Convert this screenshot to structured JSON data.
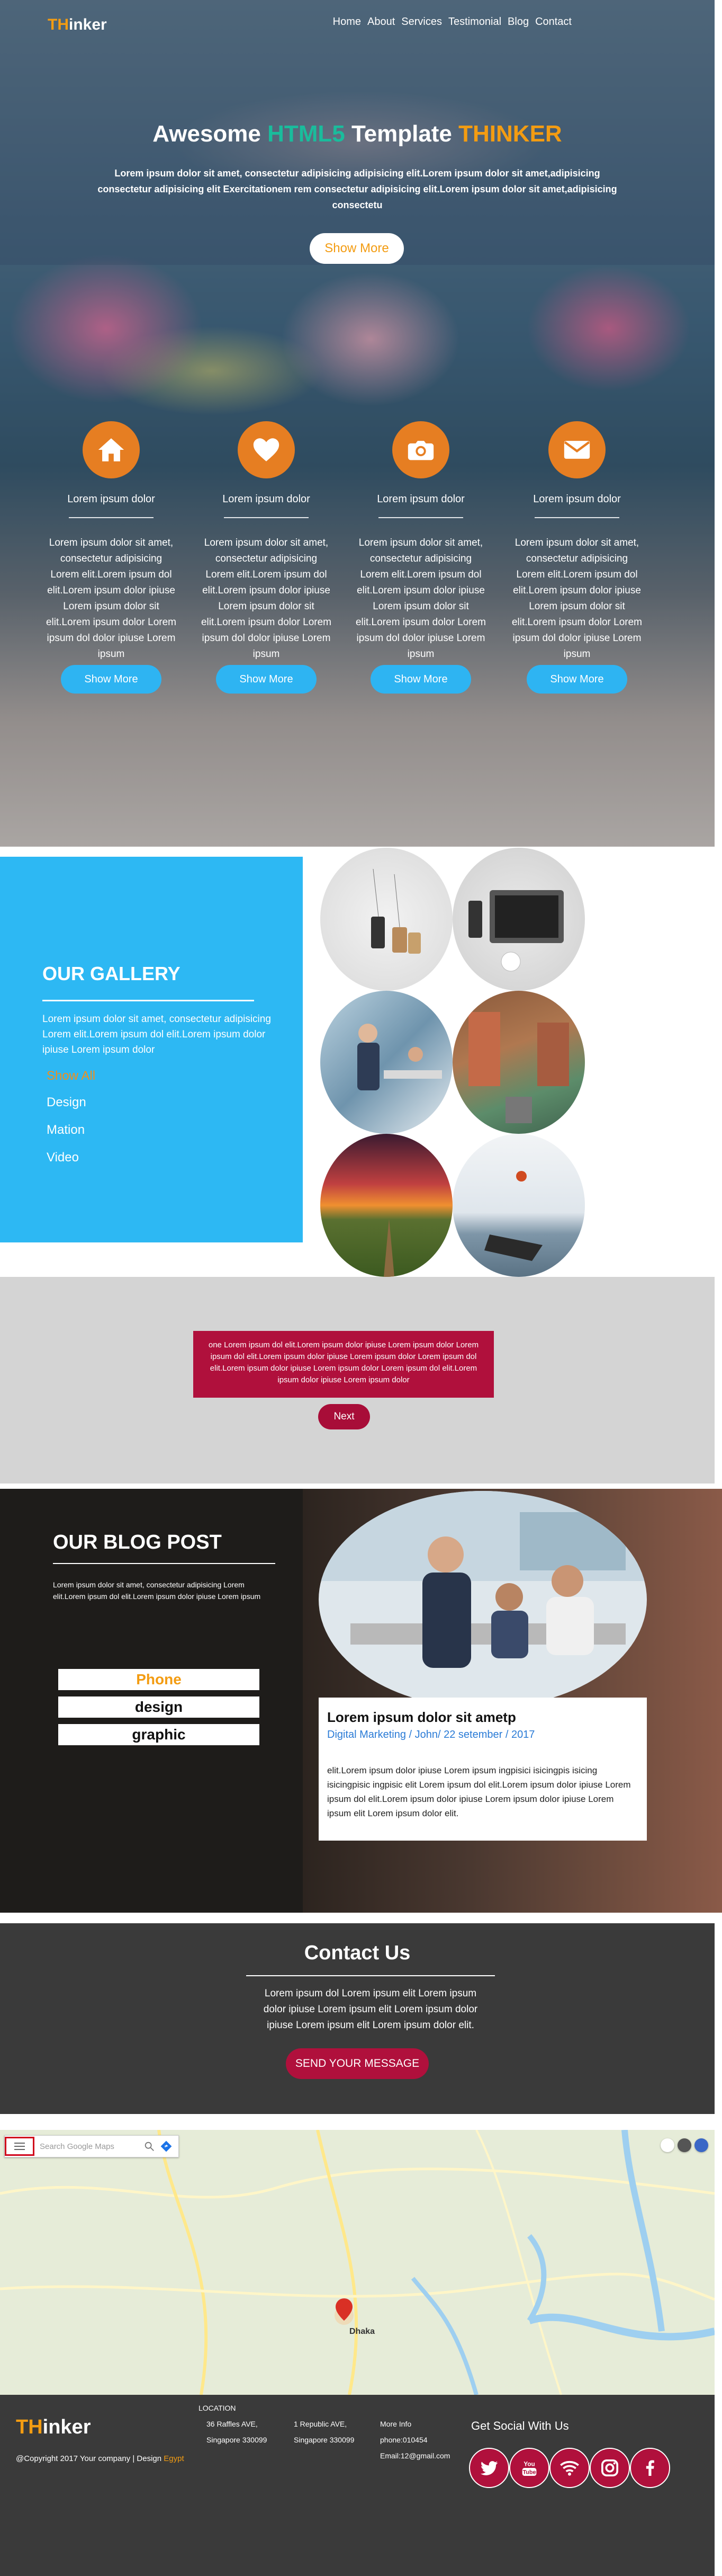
{
  "brand": {
    "logo_accent": "TH",
    "logo_rest": "inker"
  },
  "nav": {
    "items": [
      "Home",
      "About",
      "Services",
      "Testimonial",
      "Blog",
      "Contact"
    ]
  },
  "hero": {
    "title_pre": "Awesome ",
    "title_html5": "HTML5",
    "title_mid": " Template ",
    "title_brand": "THINKER",
    "description": "Lorem ipsum dolor sit amet, consectetur adipisicing adipisicing elit.Lorem ipsum dolor sit amet,adipisicing consectetur adipisicing elit Exercitationem rem consectetur adipisicing elit.Lorem ipsum dolor sit amet,adipisicing consectetu",
    "button": "Show More"
  },
  "features": [
    {
      "icon": "home-icon",
      "title": "Lorem ipsum dolor",
      "text": "Lorem ipsum dolor sit amet, consectetur adipisicing Lorem elit.Lorem ipsum dol elit.Lorem ipsum dolor ipiuse Lorem ipsum dolor sit elit.Lorem ipsum dolor Lorem ipsum dol dolor ipiuse Lorem ipsum",
      "button": "Show More"
    },
    {
      "icon": "heart-icon",
      "title": "Lorem ipsum dolor",
      "text": "Lorem ipsum dolor sit amet, consectetur adipisicing Lorem elit.Lorem ipsum dol elit.Lorem ipsum dolor ipiuse Lorem ipsum dolor sit elit.Lorem ipsum dolor Lorem ipsum dol dolor ipiuse Lorem ipsum",
      "button": "Show More"
    },
    {
      "icon": "camera-icon",
      "title": "Lorem ipsum dolor",
      "text": "Lorem ipsum dolor sit amet, consectetur adipisicing Lorem elit.Lorem ipsum dol elit.Lorem ipsum dolor ipiuse Lorem ipsum dolor sit elit.Lorem ipsum dolor Lorem ipsum dol dolor ipiuse Lorem ipsum",
      "button": "Show More"
    },
    {
      "icon": "envelope-icon",
      "title": "Lorem ipsum dolor",
      "text": "Lorem ipsum dolor sit amet, consectetur adipisicing Lorem elit.Lorem ipsum dol elit.Lorem ipsum dolor ipiuse Lorem ipsum dolor sit elit.Lorem ipsum dolor Lorem ipsum dol dolor ipiuse Lorem ipsum",
      "button": "Show More"
    }
  ],
  "gallery": {
    "title": "OUR GALLERY",
    "description": "Lorem ipsum dolor sit amet, consectetur adipisicing Lorem elit.Lorem ipsum dol elit.Lorem ipsum dolor ipiuse Lorem ipsum dolor",
    "filters": [
      "Show All",
      "Design",
      "Mation",
      "Video"
    ]
  },
  "testimonial": {
    "text": "one Lorem ipsum dol elit.Lorem ipsum dolor ipiuse Lorem ipsum dolor Lorem ipsum dol elit.Lorem ipsum dolor ipiuse Lorem ipsum dolor Lorem ipsum dol elit.Lorem ipsum dolor ipiuse Lorem ipsum dolor Lorem ipsum dol elit.Lorem ipsum dolor ipiuse Lorem ipsum dolor",
    "button": "Next"
  },
  "blog": {
    "title": "OUR BLOG POST",
    "description": "Lorem ipsum dolor sit amet, consectetur adipisicing Lorem elit.Lorem ipsum dol elit.Lorem ipsum dolor ipiuse Lorem ipsum",
    "tags": [
      "Phone",
      "design",
      "graphic"
    ],
    "post_title": "Lorem ipsum dolor sit ametp",
    "post_meta": "Digital Marketing / John/ 22 setember / 2017",
    "post_text": "elit.Lorem ipsum dolor ipiuse Lorem ipsum ingpisici isicingpis isicing isicingpisic ingpisic elit Lorem ipsum dol elit.Lorem ipsum dolor ipiuse Lorem ipsum dol elit.Lorem ipsum dolor ipiuse Lorem ipsum dolor ipiuse Lorem ipsum elit Lorem ipsum dolor elit."
  },
  "contact": {
    "title": "Contact Us",
    "description": "Lorem ipsum dol Lorem ipsum elit Lorem ipsum dolor ipiuse Lorem ipsum elit Lorem ipsum dolor ipiuse Lorem ipsum elit Lorem ipsum dolor elit.",
    "button": "SEND YOUR MESSAGE"
  },
  "map": {
    "search_placeholder": "Search Google Maps",
    "city_label": "Dhaka"
  },
  "footer": {
    "logo_accent": "TH",
    "logo_rest": "inker",
    "copyright": "@Copyright 2017 Your company | Design ",
    "copyright_link": "Egypt",
    "location_label": "LOCATION",
    "addr1_line1": "36 Raffles AVE,",
    "addr1_line2": "Singapore 330099",
    "addr2_line1": "1 Republic AVE,",
    "addr2_line2": "Singapore 330099",
    "more_info": "More Info",
    "phone": "phone:010454",
    "email": "Email:12@gmail.com",
    "social_title": "Get Social With Us",
    "social_icons": [
      "twitter-icon",
      "youtube-icon",
      "wifi-icon",
      "instagram-icon",
      "facebook-icon"
    ]
  },
  "colors": {
    "accent_orange": "#f39c12",
    "accent_blue": "#2db8f3",
    "accent_crimson": "#b0103c",
    "html5_teal": "#1abc9c"
  }
}
